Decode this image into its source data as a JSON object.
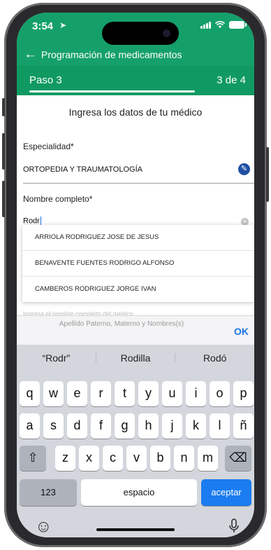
{
  "status": {
    "time": "3:54"
  },
  "appbar": {
    "title": "Programación de medicamentos",
    "back_icon": "arrow-left-icon"
  },
  "stepper": {
    "label": "Paso 3",
    "count": "3 de 4",
    "progress": 0.75
  },
  "form": {
    "title": "Ingresa los datos de tu médico",
    "specialty": {
      "label": "Especialidad*",
      "value": "ORTOPEDIA Y TRAUMATOLOGÍA"
    },
    "name": {
      "label": "Nombre completo*",
      "value": "Rodr"
    },
    "helper": "Ingresa el nombre completo del médico"
  },
  "suggestions": [
    "ARRIOLA RODRIGUEZ JOSE DE JESUS",
    "BENAVENTE FUENTES RODRIGO ALFONSO",
    "CAMBEROS RODRIGUEZ JORGE IVAN"
  ],
  "accessory": {
    "hint": "Apellido Paterno, Materno y Nombres(s)",
    "ok": "OK"
  },
  "keyboard": {
    "predictions": [
      "“Rodr”",
      "Rodilla",
      "Rodó"
    ],
    "row1": [
      "q",
      "w",
      "e",
      "r",
      "t",
      "y",
      "u",
      "i",
      "o",
      "p"
    ],
    "row2": [
      "a",
      "s",
      "d",
      "f",
      "g",
      "h",
      "j",
      "k",
      "l",
      "ñ"
    ],
    "row3": [
      "z",
      "x",
      "c",
      "v",
      "b",
      "n",
      "m"
    ],
    "numbers": "123",
    "space": "espacio",
    "enter": "aceptar",
    "shift": "⇧",
    "delete": "⌫",
    "emoji": "☺",
    "mic": "🎙"
  },
  "colors": {
    "primary": "#15a06a",
    "accent": "#1a7cf0",
    "edit": "#1f4fa5"
  }
}
